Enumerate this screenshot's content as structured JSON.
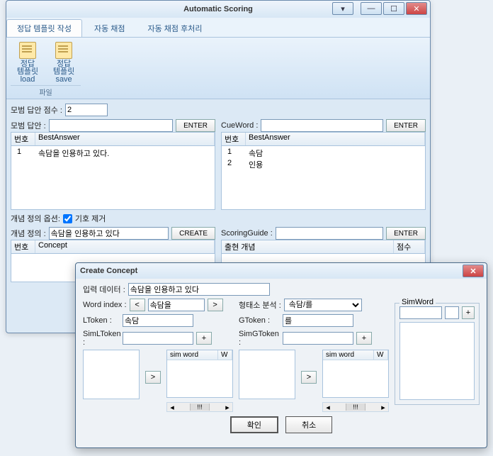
{
  "window": {
    "title": "Automatic Scoring",
    "tabs": [
      "정답 템플릿 작성",
      "자동 채점",
      "자동 채점 후처리"
    ],
    "ribbon": {
      "group_label": "파일",
      "buttons": [
        {
          "label": "정답\n템플릿 load"
        },
        {
          "label": "정답\n템플릿 save"
        }
      ]
    }
  },
  "fields": {
    "score_label": "모범 답안 점수 :",
    "score_value": "2",
    "best_answer_label": "모범 답안 :",
    "best_answer_value": "",
    "enter": "ENTER",
    "cueword_label": "CueWord :",
    "cueword_value": "",
    "concept_option_label": "개념 정의 옵션:",
    "checkbox_label": "기호 제거",
    "concept_def_label": "개념 정의 :",
    "concept_def_value": "속담을 인용하고 있다",
    "create": "CREATE",
    "scoring_guide_label": "ScoringGuide :",
    "scoring_guide_value": ""
  },
  "best_table": {
    "cols": [
      "번호",
      "BestAnswer"
    ],
    "rows": [
      {
        "no": "1",
        "text": "속담을 인용하고 있다."
      }
    ]
  },
  "cue_table": {
    "cols": [
      "번호",
      "BestAnswer"
    ],
    "rows": [
      {
        "no": "1",
        "text": "속담"
      },
      {
        "no": "2",
        "text": "인용"
      }
    ]
  },
  "concept_table": {
    "cols": [
      "번호",
      "Concept"
    ]
  },
  "scoring_table": {
    "cols": [
      "출현 개념",
      "점수"
    ]
  },
  "dialog": {
    "title": "Create Concept",
    "input_label": "입력 데이터 :",
    "input_value": "속담을 인용하고 있다",
    "word_index_label": "Word index :",
    "word_index_value": "속담을",
    "morph_label": "형태소 분석 :",
    "morph_value": "속담/를",
    "ltoken_label": "LToken :",
    "ltoken_value": "속담",
    "simltoken_label": "SimLToken :",
    "simltoken_value": "",
    "gtoken_label": "GToken :",
    "gtoken_value": "를",
    "simgtoken_label": "SimGToken :",
    "simgtoken_value": "",
    "simword_legend": "SimWord",
    "simword_cols": [
      "sim word",
      "W"
    ],
    "scroll_label": "!!!",
    "ok": "확인",
    "cancel": "취소",
    "lt": "<",
    "gt": ">",
    "plus": "+"
  }
}
